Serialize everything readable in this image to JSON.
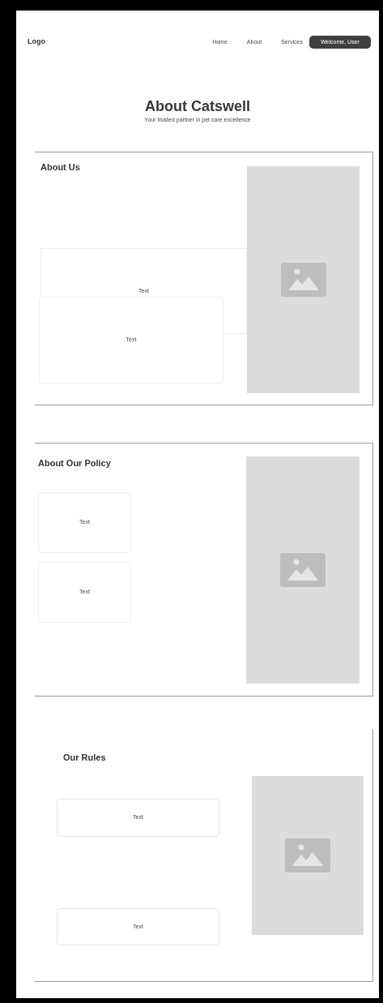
{
  "nav": {
    "logo": "Logo",
    "links": [
      "Home",
      "About",
      "Services"
    ],
    "user_button": "Welcome, User"
  },
  "header": {
    "title": "About Catswell",
    "subtitle": "Your trusted partner in pet care excellence"
  },
  "sections": [
    {
      "kind": "overlap",
      "heading": "About Us",
      "cards": [
        "Text",
        "Text"
      ]
    },
    {
      "kind": "stacked",
      "heading": "About Our Policy",
      "cards": [
        "Text",
        "Text"
      ]
    },
    {
      "kind": "spaced",
      "heading": "Our Rules",
      "cards": [
        "Text",
        "Text"
      ]
    }
  ]
}
